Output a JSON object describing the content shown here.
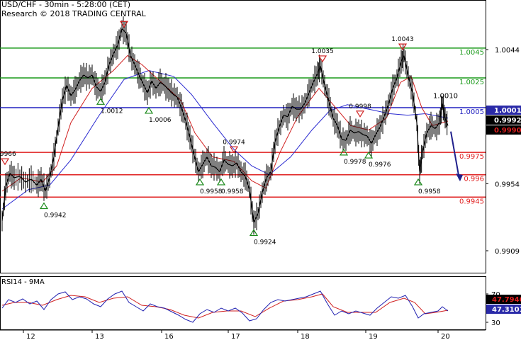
{
  "header": {
    "line1": "USD/CHF - 30min - 5:28:00 (CET)",
    "line2": "Research © 2018 TRADING CENTRAL"
  },
  "chart_data": {
    "type": "line",
    "y_ticks": [
      {
        "label": "1.0044",
        "value": 1.0044
      },
      {
        "label": "0.9954",
        "value": 0.9954
      },
      {
        "label": "0.9909",
        "value": 0.9909
      }
    ],
    "x_ticks": [
      "12",
      "13",
      "16",
      "17",
      "18",
      "19",
      "20"
    ],
    "price_boxes": [
      {
        "label": "1.00017",
        "value": 1.00017,
        "bg": "#2a2aa8",
        "fg": "#ffffff"
      },
      {
        "label": "0.99929",
        "value": 0.99929,
        "bg": "#000000",
        "fg": "#ffffff"
      },
      {
        "label": "0.99907",
        "value": 0.99907,
        "bg": "#000000",
        "fg": "#e02020"
      }
    ],
    "levels": [
      {
        "label": "1.0045",
        "value": 1.0045,
        "color": "#1a9a1a"
      },
      {
        "label": "1.0025",
        "value": 1.0025,
        "color": "#1a9a1a"
      },
      {
        "label": "1.0005",
        "value": 1.0005,
        "color": "#2020c0"
      },
      {
        "label": "0.9975",
        "value": 0.9975,
        "color": "#e02020"
      },
      {
        "label": "0.996",
        "value": 0.996,
        "color": "#e02020"
      },
      {
        "label": "0.9945",
        "value": 0.9945,
        "color": "#e02020"
      }
    ],
    "extra_labels": [
      {
        "label": "1.0010",
        "value": 1.001
      }
    ],
    "pivots": [
      {
        "label": "0.9966",
        "x": 7,
        "value": 0.9966,
        "type": "high"
      },
      {
        "label": "0.9942",
        "x": 62,
        "value": 0.9942,
        "type": "low"
      },
      {
        "label": "1.0012",
        "x": 142,
        "value": 1.0012,
        "type": "low"
      },
      {
        "label": "1.0006",
        "x": 210,
        "value": 1.0006,
        "type": "low"
      },
      {
        "label": "0.9958",
        "x": 282,
        "value": 0.9958,
        "type": "low"
      },
      {
        "label": "0.9958",
        "x": 312,
        "value": 0.9958,
        "type": "low"
      },
      {
        "label": "0.9974",
        "x": 330,
        "value": 0.9974,
        "type": "high"
      },
      {
        "label": "0.9924",
        "x": 358,
        "value": 0.9924,
        "type": "low"
      },
      {
        "label": "1.0035",
        "x": 455,
        "value": 1.0035,
        "type": "high"
      },
      {
        "label": "0.9978",
        "x": 485,
        "value": 0.9978,
        "type": "low"
      },
      {
        "label": "0.9998",
        "x": 508,
        "value": 0.9998,
        "type": "high"
      },
      {
        "label": "0.9976",
        "x": 520,
        "value": 0.9976,
        "type": "low"
      },
      {
        "label": "1.0043",
        "x": 568,
        "value": 1.0043,
        "type": "high"
      },
      {
        "label": "0.9958",
        "x": 590,
        "value": 0.9958,
        "type": "low"
      }
    ],
    "top_marker": {
      "x": 175,
      "value": 1.0061
    },
    "price_path": [
      [
        3,
        0.9929
      ],
      [
        8,
        0.9952
      ],
      [
        14,
        0.9961
      ],
      [
        20,
        0.9958
      ],
      [
        28,
        0.9959
      ],
      [
        36,
        0.9955
      ],
      [
        44,
        0.9957
      ],
      [
        52,
        0.9953
      ],
      [
        58,
        0.9957
      ],
      [
        64,
        0.9949
      ],
      [
        70,
        0.9958
      ],
      [
        76,
        0.9972
      ],
      [
        82,
        0.9992
      ],
      [
        88,
        1.001
      ],
      [
        94,
        1.002
      ],
      [
        100,
        1.0013
      ],
      [
        106,
        1.0017
      ],
      [
        112,
        1.0023
      ],
      [
        118,
        1.0027
      ],
      [
        124,
        1.0025
      ],
      [
        130,
        1.0027
      ],
      [
        136,
        1.0019
      ],
      [
        142,
        1.0016
      ],
      [
        148,
        1.0022
      ],
      [
        154,
        1.0034
      ],
      [
        160,
        1.0041
      ],
      [
        166,
        1.0047
      ],
      [
        172,
        1.0058
      ],
      [
        178,
        1.0055
      ],
      [
        184,
        1.004
      ],
      [
        190,
        1.0034
      ],
      [
        196,
        1.0027
      ],
      [
        202,
        1.0021
      ],
      [
        208,
        1.0015
      ],
      [
        214,
        1.0023
      ],
      [
        220,
        1.0018
      ],
      [
        226,
        1.0022
      ],
      [
        232,
        1.002
      ],
      [
        238,
        1.0017
      ],
      [
        244,
        1.0014
      ],
      [
        250,
        1.0012
      ],
      [
        256,
        1.0005
      ],
      [
        262,
        0.9996
      ],
      [
        268,
        0.9985
      ],
      [
        274,
        0.9973
      ],
      [
        280,
        0.9962
      ],
      [
        286,
        0.9967
      ],
      [
        292,
        0.9972
      ],
      [
        298,
        0.9966
      ],
      [
        304,
        0.9965
      ],
      [
        310,
        0.9962
      ],
      [
        316,
        0.997
      ],
      [
        322,
        0.9967
      ],
      [
        328,
        0.9966
      ],
      [
        334,
        0.9968
      ],
      [
        340,
        0.9962
      ],
      [
        346,
        0.9959
      ],
      [
        352,
        0.995
      ],
      [
        358,
        0.9928
      ],
      [
        364,
        0.9934
      ],
      [
        370,
        0.9948
      ],
      [
        376,
        0.9958
      ],
      [
        382,
        0.9962
      ],
      [
        388,
        0.9982
      ],
      [
        394,
        0.9992
      ],
      [
        400,
        1.0
      ],
      [
        406,
        0.9999
      ],
      [
        412,
        1.0006
      ],
      [
        418,
        1.0004
      ],
      [
        424,
        1.0004
      ],
      [
        430,
        1.0008
      ],
      [
        436,
        1.0015
      ],
      [
        442,
        1.0022
      ],
      [
        448,
        1.0028
      ],
      [
        452,
        1.0033
      ],
      [
        458,
        1.002
      ],
      [
        464,
        1.0009
      ],
      [
        470,
        0.9998
      ],
      [
        476,
        0.9993
      ],
      [
        482,
        0.9984
      ],
      [
        488,
        0.9983
      ],
      [
        494,
        0.999
      ],
      [
        500,
        0.9988
      ],
      [
        506,
        0.9989
      ],
      [
        512,
        0.9987
      ],
      [
        518,
        0.9986
      ],
      [
        524,
        0.9981
      ],
      [
        530,
        0.9987
      ],
      [
        536,
        0.9992
      ],
      [
        542,
        0.9999
      ],
      [
        548,
        1.0007
      ],
      [
        554,
        1.0018
      ],
      [
        560,
        1.0025
      ],
      [
        566,
        1.0036
      ],
      [
        570,
        1.004
      ],
      [
        576,
        1.0026
      ],
      [
        582,
        1.0015
      ],
      [
        588,
        0.9995
      ],
      [
        592,
        0.9962
      ],
      [
        596,
        0.9975
      ],
      [
        602,
        0.9988
      ],
      [
        608,
        0.9993
      ],
      [
        614,
        0.9991
      ],
      [
        620,
        0.9995
      ],
      [
        624,
        1.0008
      ],
      [
        628,
        0.9998
      ],
      [
        632,
        0.9993
      ]
    ],
    "ma_fast": [
      [
        3,
        0.9949
      ],
      [
        30,
        0.9958
      ],
      [
        60,
        0.9955
      ],
      [
        80,
        0.9966
      ],
      [
        100,
        0.9995
      ],
      [
        130,
        1.0018
      ],
      [
        160,
        1.003
      ],
      [
        180,
        1.004
      ],
      [
        200,
        1.0034
      ],
      [
        230,
        1.0021
      ],
      [
        255,
        1.001
      ],
      [
        275,
        0.9988
      ],
      [
        300,
        0.9972
      ],
      [
        330,
        0.9969
      ],
      [
        355,
        0.9956
      ],
      [
        375,
        0.9951
      ],
      [
        395,
        0.9975
      ],
      [
        420,
        0.9999
      ],
      [
        450,
        1.0018
      ],
      [
        470,
        1.0007
      ],
      [
        495,
        0.9993
      ],
      [
        520,
        0.999
      ],
      [
        545,
        0.9998
      ],
      [
        565,
        1.0022
      ],
      [
        580,
        1.0026
      ],
      [
        595,
        1.0005
      ],
      [
        610,
        0.9993
      ],
      [
        632,
        0.9996
      ]
    ],
    "ma_slow": [
      [
        3,
        0.9937
      ],
      [
        40,
        0.995
      ],
      [
        70,
        0.9953
      ],
      [
        100,
        0.997
      ],
      [
        140,
        1.0
      ],
      [
        175,
        1.0024
      ],
      [
        210,
        1.003
      ],
      [
        245,
        1.0026
      ],
      [
        270,
        1.0014
      ],
      [
        300,
        0.9995
      ],
      [
        330,
        0.9977
      ],
      [
        355,
        0.9966
      ],
      [
        380,
        0.996
      ],
      [
        410,
        0.9972
      ],
      [
        440,
        0.999
      ],
      [
        465,
        1.0003
      ],
      [
        490,
        1.0007
      ],
      [
        520,
        1.0004
      ],
      [
        550,
        1.0001
      ],
      [
        575,
        1.0
      ],
      [
        600,
        1.0001
      ],
      [
        632,
        0.9998
      ]
    ],
    "forecast_arrow": {
      "from": [
        636,
        0.9989
      ],
      "to": [
        648,
        0.9957
      ],
      "color": "#20208c"
    },
    "rsi": {
      "title": "RSI14 - 9MA",
      "ticks": [
        {
          "label": "70",
          "value": 70
        },
        {
          "label": "30",
          "value": 30
        }
      ],
      "value_boxes": [
        {
          "label": "47.7946",
          "value": 47.7946,
          "bg": "#000000",
          "fg": "#e02020"
        },
        {
          "label": "47.3101",
          "value": 47.3101,
          "bg": "#2a2aa8",
          "fg": "#ffffff"
        }
      ],
      "line": [
        [
          3,
          50
        ],
        [
          12,
          62
        ],
        [
          22,
          58
        ],
        [
          32,
          63
        ],
        [
          42,
          56
        ],
        [
          52,
          60
        ],
        [
          62,
          48
        ],
        [
          72,
          62
        ],
        [
          82,
          70
        ],
        [
          92,
          73
        ],
        [
          102,
          62
        ],
        [
          112,
          66
        ],
        [
          122,
          63
        ],
        [
          132,
          56
        ],
        [
          142,
          52
        ],
        [
          152,
          63
        ],
        [
          162,
          70
        ],
        [
          172,
          74
        ],
        [
          182,
          58
        ],
        [
          192,
          52
        ],
        [
          202,
          46
        ],
        [
          212,
          56
        ],
        [
          222,
          52
        ],
        [
          232,
          50
        ],
        [
          242,
          45
        ],
        [
          252,
          40
        ],
        [
          262,
          34
        ],
        [
          272,
          30
        ],
        [
          282,
          42
        ],
        [
          292,
          48
        ],
        [
          302,
          44
        ],
        [
          312,
          50
        ],
        [
          322,
          46
        ],
        [
          332,
          50
        ],
        [
          342,
          43
        ],
        [
          352,
          32
        ],
        [
          362,
          35
        ],
        [
          372,
          48
        ],
        [
          382,
          58
        ],
        [
          392,
          62
        ],
        [
          402,
          60
        ],
        [
          412,
          62
        ],
        [
          422,
          64
        ],
        [
          432,
          66
        ],
        [
          442,
          70
        ],
        [
          452,
          74
        ],
        [
          462,
          56
        ],
        [
          472,
          40
        ],
        [
          482,
          46
        ],
        [
          492,
          42
        ],
        [
          502,
          46
        ],
        [
          512,
          43
        ],
        [
          522,
          40
        ],
        [
          532,
          50
        ],
        [
          542,
          58
        ],
        [
          552,
          66
        ],
        [
          562,
          64
        ],
        [
          572,
          68
        ],
        [
          582,
          52
        ],
        [
          590,
          36
        ],
        [
          598,
          42
        ],
        [
          608,
          44
        ],
        [
          618,
          46
        ],
        [
          624,
          52
        ],
        [
          632,
          46
        ]
      ],
      "ma": [
        [
          3,
          54
        ],
        [
          20,
          58
        ],
        [
          40,
          58
        ],
        [
          60,
          54
        ],
        [
          80,
          62
        ],
        [
          100,
          68
        ],
        [
          120,
          66
        ],
        [
          140,
          58
        ],
        [
          160,
          64
        ],
        [
          180,
          66
        ],
        [
          200,
          54
        ],
        [
          220,
          52
        ],
        [
          240,
          48
        ],
        [
          260,
          40
        ],
        [
          280,
          36
        ],
        [
          300,
          44
        ],
        [
          320,
          46
        ],
        [
          340,
          46
        ],
        [
          360,
          38
        ],
        [
          380,
          50
        ],
        [
          400,
          60
        ],
        [
          420,
          62
        ],
        [
          440,
          66
        ],
        [
          455,
          70
        ],
        [
          470,
          52
        ],
        [
          490,
          44
        ],
        [
          510,
          44
        ],
        [
          530,
          44
        ],
        [
          550,
          58
        ],
        [
          570,
          64
        ],
        [
          585,
          58
        ],
        [
          600,
          42
        ],
        [
          615,
          44
        ],
        [
          632,
          47
        ]
      ]
    }
  }
}
